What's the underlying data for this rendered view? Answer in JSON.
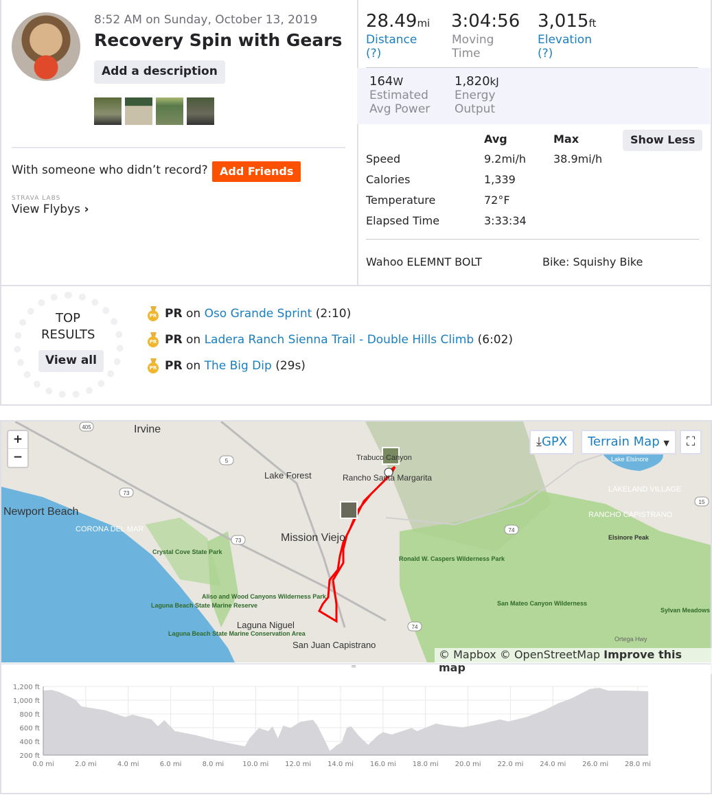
{
  "activity": {
    "datetime": "8:52 AM on Sunday, October 13, 2019",
    "title": "Recovery Spin with Gears",
    "add_description": "Add a description",
    "photos": 4,
    "with_prompt": "With someone who didn’t record?",
    "add_friends": "Add Friends",
    "labs": "STRAVA LABS",
    "flybys": "View Flybys",
    "flybys_chevron": "›"
  },
  "stats": {
    "distance": {
      "value": "28.49",
      "unit": "mi",
      "label": "Distance",
      "help": "(?)"
    },
    "moving_time": {
      "value": "3:04:56",
      "label1": "Moving",
      "label2": "Time"
    },
    "elevation": {
      "value": "3,015",
      "unit": "ft",
      "label": "Elevation",
      "help": "(?)"
    },
    "power": {
      "value": "164",
      "unit": "W",
      "label1": "Estimated",
      "label2": "Avg Power"
    },
    "energy": {
      "value": "1,820",
      "unit": "kJ",
      "label1": "Energy",
      "label2": "Output"
    }
  },
  "details": {
    "col_avg": "Avg",
    "col_max": "Max",
    "show_less": "Show Less",
    "rows": [
      {
        "label": "Speed",
        "avg": "9.2mi/h",
        "max": "38.9mi/h"
      },
      {
        "label": "Calories",
        "avg": "1,339",
        "max": ""
      },
      {
        "label": "Temperature",
        "avg": "72°F",
        "max": ""
      },
      {
        "label": "Elapsed Time",
        "avg": "3:33:34",
        "max": ""
      }
    ],
    "device": "Wahoo ELEMNT BOLT",
    "bike": "Bike: Squishy Bike"
  },
  "top_results": {
    "title1": "TOP",
    "title2": "RESULTS",
    "view_all": "View all",
    "items": [
      {
        "badge": "PR",
        "on": "on",
        "segment": "Oso Grande Sprint",
        "time": "(2:10)"
      },
      {
        "badge": "PR",
        "on": "on",
        "segment": "Ladera Ranch Sienna Trail - Double Hills Climb",
        "time": "(6:02)"
      },
      {
        "badge": "PR",
        "on": "on",
        "segment": "The Big Dip",
        "time": "(29s)"
      }
    ]
  },
  "map": {
    "zoom_in": "+",
    "zoom_out": "−",
    "gpx": "GPX",
    "map_type": "Terrain Map",
    "attribution": "© Mapbox © OpenStreetMap",
    "improve": "Improve this map",
    "colors": {
      "water": "#6cb4dd",
      "land": "#e8e6df",
      "park": "#a9d38d",
      "route": "#fc0000"
    },
    "labels": [
      "Irvine",
      "Newport Beach",
      "CORONA DEL MAR",
      "Lake Forest",
      "Mission Viejo",
      "Rancho Santa Margarita",
      "Trabuco Canyon",
      "Crystal Cove State Park",
      "Aliso and Wood Canyons Wilderness Park",
      "Laguna Beach State Marine Reserve",
      "Laguna Beach State Marine Conservation Area",
      "Laguna Niguel",
      "San Juan Capistrano",
      "Ronald W. Caspers Wilderness Park",
      "San Mateo Canyon Wilderness",
      "Lake Elsinore",
      "LAKELAND VILLAGE",
      "RANCHO CAPISTRANO",
      "Elsinore Peak",
      "Sylvan Meadows",
      "Ortega Hwy"
    ],
    "shields": [
      "405",
      "5",
      "73",
      "73",
      "74",
      "74",
      "15"
    ]
  },
  "chart_data": {
    "type": "area",
    "xlabel": "",
    "ylabel": "",
    "xlim": [
      0,
      28.49
    ],
    "ylim": [
      200,
      1200
    ],
    "x_ticks": [
      "0.0 mi",
      "2.0 mi",
      "4.0 mi",
      "6.0 mi",
      "8.0 mi",
      "10.0 mi",
      "12.0 mi",
      "14.0 mi",
      "16.0 mi",
      "18.0 mi",
      "20.0 mi",
      "22.0 mi",
      "24.0 mi",
      "26.0 mi",
      "28.0 mi"
    ],
    "y_ticks": [
      "1,200 ft",
      "1,000 ft",
      "800 ft",
      "600 ft",
      "400 ft",
      "200 ft"
    ],
    "grid": true,
    "color": "#d6d6da",
    "x": [
      0,
      0.4,
      0.75,
      1.5,
      1.8,
      2.9,
      3.85,
      4.2,
      5.1,
      5.4,
      5.7,
      6.2,
      7.2,
      8.2,
      9.3,
      9.5,
      9.7,
      10.15,
      10.6,
      10.8,
      11.05,
      11.3,
      11.65,
      12.1,
      12.4,
      12.7,
      12.9,
      13.25,
      13.5,
      13.8,
      14.05,
      14.3,
      14.5,
      14.85,
      15.3,
      15.75,
      16,
      16.4,
      16.75,
      17.35,
      17.6,
      18.5,
      18.9,
      19.75,
      20.6,
      21.5,
      21.9,
      22.75,
      23.6,
      24.25,
      24.9,
      25.75,
      26.2,
      26.6,
      27.45,
      28,
      28.49
    ],
    "y": [
      1140,
      1150,
      1120,
      1010,
      910,
      855,
      755,
      790,
      720,
      620,
      710,
      550,
      490,
      410,
      340,
      330,
      440,
      595,
      550,
      620,
      445,
      630,
      595,
      685,
      700,
      715,
      635,
      420,
      260,
      340,
      385,
      600,
      620,
      485,
      350,
      485,
      535,
      500,
      535,
      595,
      550,
      660,
      635,
      605,
      655,
      720,
      690,
      755,
      855,
      955,
      1030,
      1165,
      1180,
      1140,
      1140,
      1135,
      1130
    ]
  }
}
